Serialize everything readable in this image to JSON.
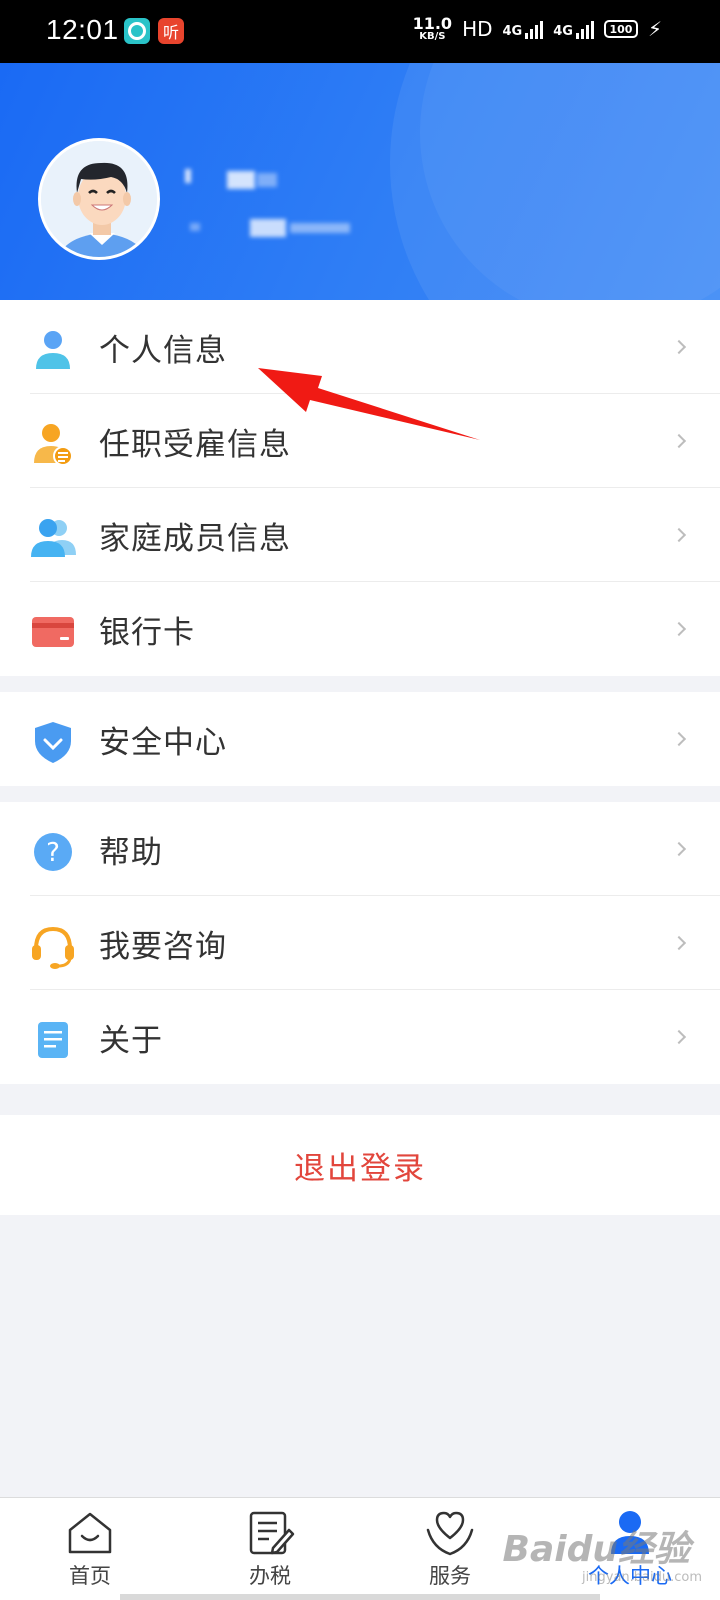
{
  "status_bar": {
    "time": "12:01",
    "app_badge_2": "听",
    "net_speed_value": "11.0",
    "net_speed_unit": "KB/S",
    "hd_label": "HD",
    "network1": "4G",
    "network2": "4G",
    "battery": "100"
  },
  "profile": {
    "avatar_icon": "user-avatar-illustration"
  },
  "menu_group_1": [
    {
      "label": "个人信息",
      "icon": "person-icon"
    },
    {
      "label": "任职受雇信息",
      "icon": "employment-icon"
    },
    {
      "label": "家庭成员信息",
      "icon": "family-icon"
    },
    {
      "label": "银行卡",
      "icon": "bank-card-icon"
    }
  ],
  "menu_group_2": [
    {
      "label": "安全中心",
      "icon": "shield-icon"
    }
  ],
  "menu_group_3": [
    {
      "label": "帮助",
      "icon": "help-icon"
    },
    {
      "label": "我要咨询",
      "icon": "headset-icon"
    },
    {
      "label": "关于",
      "icon": "document-icon"
    }
  ],
  "logout_label": "退出登录",
  "bottom_nav": [
    {
      "label": "首页",
      "icon": "home-icon"
    },
    {
      "label": "办税",
      "icon": "edit-doc-icon"
    },
    {
      "label": "服务",
      "icon": "heart-hand-icon"
    },
    {
      "label": "个人中心",
      "icon": "user-center-icon",
      "active": true
    }
  ],
  "watermark": "Baidu经验",
  "watermark_sub": "jingyan.baidu.com",
  "colors": {
    "primary": "#1a6af4",
    "logout": "#e2463c",
    "annotation_arrow": "#f01a14"
  }
}
